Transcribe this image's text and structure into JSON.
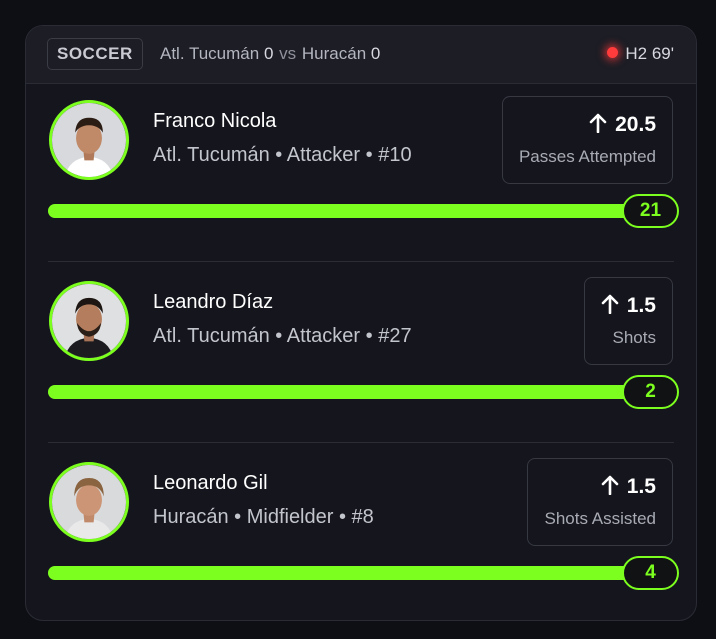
{
  "header": {
    "sport": "SOCCER",
    "home_team": "Atl. Tucumán",
    "home_score": "0",
    "vs": "vs",
    "away_team": "Huracán",
    "away_score": "0",
    "live_status": "H2 69'"
  },
  "colors": {
    "accent": "#7cff1e",
    "live": "#ff3b3b",
    "background": "#15161d"
  },
  "players": [
    {
      "name": "Franco Nicola",
      "meta": "Atl. Tucumán • Attacker • #10",
      "direction_icon": "arrow-up-icon",
      "line": "20.5",
      "stat": "Passes Attempted",
      "current": "21",
      "progress": 1.0
    },
    {
      "name": "Leandro Díaz",
      "meta": "Atl. Tucumán • Attacker • #27",
      "direction_icon": "arrow-up-icon",
      "line": "1.5",
      "stat": "Shots",
      "current": "2",
      "progress": 1.0
    },
    {
      "name": "Leonardo Gil",
      "meta": "Huracán • Midfielder • #8",
      "direction_icon": "arrow-up-icon",
      "line": "1.5",
      "stat": "Shots Assisted",
      "current": "4",
      "progress": 1.0
    }
  ]
}
